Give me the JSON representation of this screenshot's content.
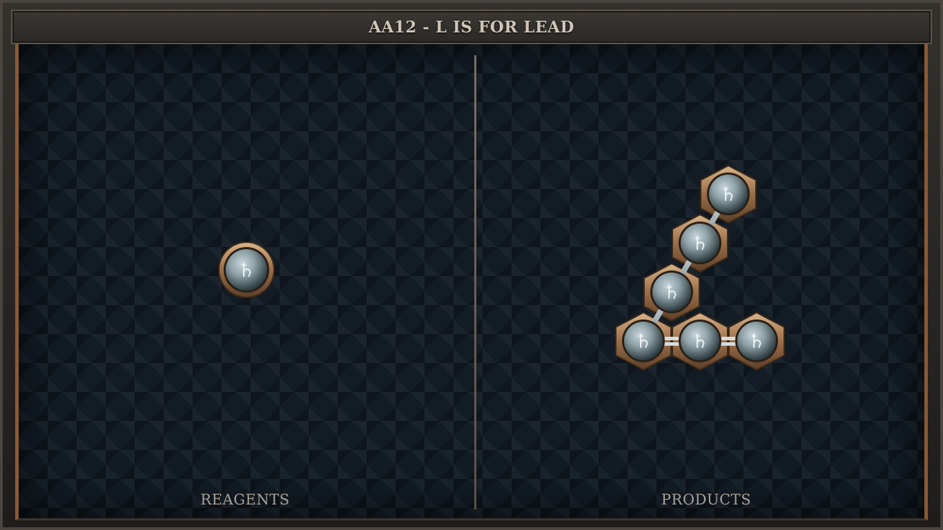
{
  "title": "AA12 - L IS FOR LEAD",
  "panels": {
    "reagents_label": "REAGENTS",
    "products_label": "PRODUCTS"
  },
  "atom_symbol": "♄",
  "atom_element": "lead",
  "reagents": {
    "atoms": 1
  },
  "products": {
    "atoms": 6,
    "bonds": 5
  },
  "colors": {
    "board_background": "#131c25",
    "frame_accent": "#8a5a33",
    "atom_rim": "#b08660",
    "atom_core": "#8fa3a8",
    "title_text": "#cfc6b8",
    "label_text": "#a8a199"
  }
}
